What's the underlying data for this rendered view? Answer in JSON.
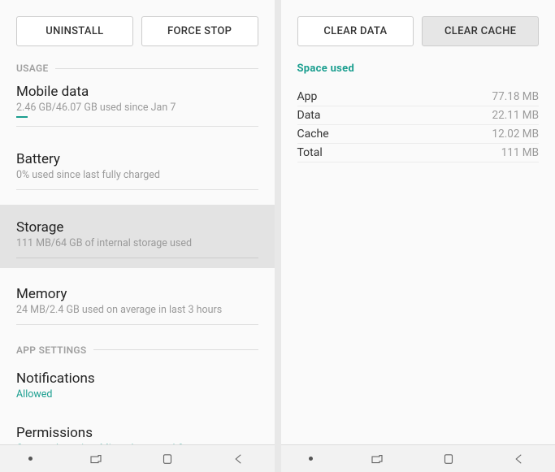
{
  "left": {
    "buttons": {
      "uninstall": "UNINSTALL",
      "forceStop": "FORCE STOP"
    },
    "sections": {
      "usage": "USAGE",
      "appSettings": "APP SETTINGS"
    },
    "items": {
      "mobileData": {
        "title": "Mobile data",
        "subtitle": "2.46 GB/46.07 GB used since Jan 7"
      },
      "battery": {
        "title": "Battery",
        "subtitle": "0% used since last fully charged"
      },
      "storage": {
        "title": "Storage",
        "subtitle": "111 MB/64 GB of internal storage used"
      },
      "memory": {
        "title": "Memory",
        "subtitle": "24 MB/2.4 GB used on average in last 3 hours"
      },
      "notifications": {
        "title": "Notifications",
        "subtitle": "Allowed"
      },
      "permissions": {
        "title": "Permissions",
        "subtitle": "Camera, Location, Microphone, and Storage"
      }
    }
  },
  "right": {
    "buttons": {
      "clearData": "CLEAR DATA",
      "clearCache": "CLEAR CACHE"
    },
    "spaceUsed": "Space used",
    "rows": {
      "app": {
        "label": "App",
        "value": "77.18 MB"
      },
      "data": {
        "label": "Data",
        "value": "22.11 MB"
      },
      "cache": {
        "label": "Cache",
        "value": "12.02 MB"
      },
      "total": {
        "label": "Total",
        "value": "111 MB"
      }
    }
  }
}
